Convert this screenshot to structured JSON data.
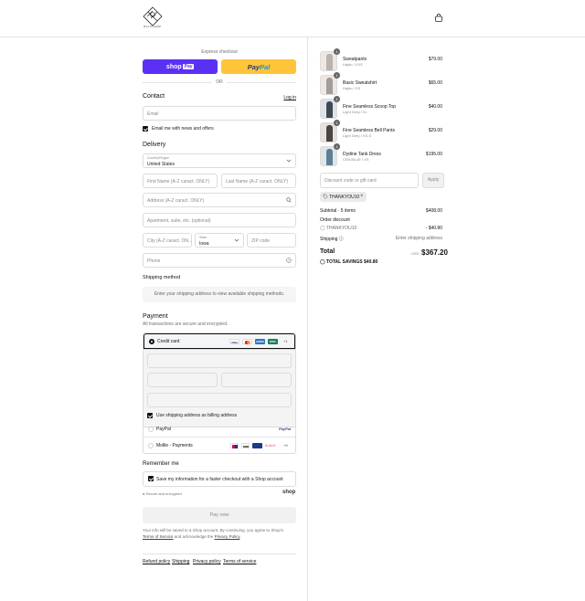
{
  "header": {
    "logo_text": "BAYCHAMP",
    "bag_icon": "shopping-bag-icon"
  },
  "express": {
    "label": "Express checkout",
    "shoppay_text": "shop",
    "shoppay_badge": "Pay",
    "paypal_text_1": "Pay",
    "paypal_text_2": "Pal",
    "or_text": "OR"
  },
  "contact": {
    "title": "Contact",
    "login_label": "Log in",
    "email_placeholder": "Email",
    "news_label": "Email me with news and offers"
  },
  "delivery": {
    "title": "Delivery",
    "country_label": "Country/Region",
    "country_value": "United States",
    "first_name_placeholder": "First Name (A-Z caract. ONLY)",
    "last_name_placeholder": "Last Name (A-Z caract. ONLY)",
    "address_placeholder": "Address (A-Z caract. ONLY)",
    "apartment_placeholder": "Apartment, suite, etc. (optional)",
    "city_placeholder": "City (A-Z caract. ON...",
    "state_label": "State",
    "state_value": "Iowa",
    "zip_placeholder": "ZIP code",
    "phone_placeholder": "Phone"
  },
  "shipping": {
    "title": "Shipping method",
    "notice": "Enter your shipping address to view available shipping methods."
  },
  "payment": {
    "title": "Payment",
    "subtitle": "All transactions are secure and encrypted.",
    "credit_card_label": "Credit card",
    "card_brands": [
      "VISA",
      "MC",
      "AMEX",
      "DISC"
    ],
    "more_brands": "+1",
    "billing_label": "Use shipping address as billing address",
    "paypal_label": "PayPal",
    "paypal_logo": "PayPal",
    "mollie_label": "Mollie - Payments",
    "mollie_brand_text": "Sofort",
    "mollie_more": "+9"
  },
  "remember": {
    "title": "Remember me",
    "save_label": "Save my information for a faster checkout with a Shop account",
    "secure_label": "Secure and encrypted",
    "shop_word": "shop"
  },
  "paynow_label": "Pay now",
  "legal": {
    "line1": "Your info will be saved to a Shop account. By continuing, you agree to Shop's",
    "tos": "Terms of Service",
    "and": " and acknowledge the ",
    "privacy": "Privacy Policy",
    "end": "."
  },
  "footer_links": [
    "Refund policy",
    "Shipping",
    "Privacy policy",
    "Terms of service"
  ],
  "order": {
    "items": [
      {
        "name": "Sweatpants",
        "variant": "Hajdu / XXS",
        "price": "$79.00",
        "qty": "1",
        "color": "#b9b2ad"
      },
      {
        "name": "Basic Sweatshirt",
        "variant": "Hajdu / XS",
        "price": "$65.00",
        "qty": "1",
        "color": "#a49c96"
      },
      {
        "name": "Fine Seamless Scoop Top",
        "variant": "Light Grey / XL",
        "price": "$40.00",
        "qty": "1",
        "color": "#3d4a56"
      },
      {
        "name": "Fine Seamless Bell Pants",
        "variant": "Light Grey / XS-S",
        "price": "$29.00",
        "qty": "1",
        "color": "#4a4442"
      },
      {
        "name": "Dydine Tank Dress",
        "variant": "CRA BLUE / XS",
        "price": "$195.00",
        "qty": "1",
        "color": "#5f7e93"
      }
    ],
    "discount_placeholder": "Discount code or gift card",
    "apply_label": "Apply",
    "tag_code": "THANKYOU10",
    "subtotal_label": "Subtotal · 5 items",
    "subtotal_value": "$408.00",
    "order_discount_label": "Order discount",
    "discount_code": "THANKYOU10",
    "discount_value": "- $40.80",
    "shipping_label": "Shipping",
    "shipping_value": "Enter shipping address",
    "total_label": "Total",
    "total_currency": "USD",
    "total_value": "$367.20",
    "savings_label": "TOTAL SAVINGS",
    "savings_value": "$40.80"
  }
}
